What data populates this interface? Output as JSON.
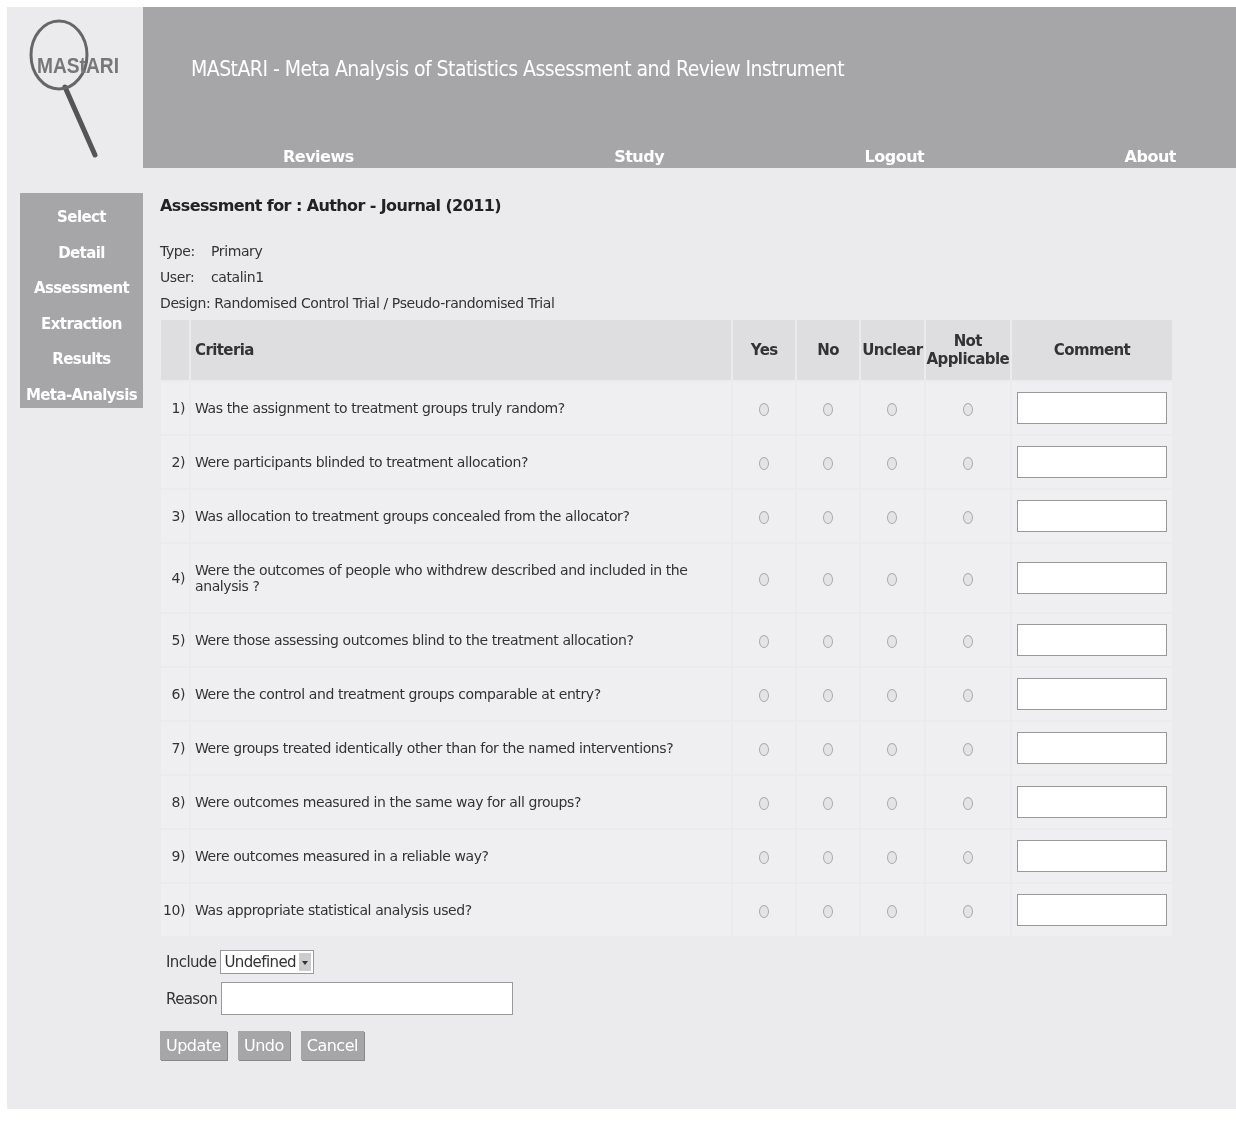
{
  "logo": {
    "text": "MAStARI"
  },
  "header": {
    "title": "MAStARI - Meta Analysis of Statistics Assessment and Review Instrument"
  },
  "nav": [
    {
      "label": "Reviews"
    },
    {
      "label": "Study"
    },
    {
      "label": "Logout"
    },
    {
      "label": "About"
    }
  ],
  "sidebar": {
    "items": [
      {
        "label": "Select"
      },
      {
        "label": "Detail"
      },
      {
        "label": "Assessment"
      },
      {
        "label": "Extraction"
      },
      {
        "label": "Results"
      },
      {
        "label": "Meta-Analysis"
      }
    ]
  },
  "heading": "Assessment for : Author - Journal (2011)",
  "details": [
    {
      "label": "Type:",
      "value": "Primary"
    },
    {
      "label": "User:",
      "value": "catalin1"
    },
    {
      "label": "Design:",
      "value": "Randomised Control Trial / Pseudo-randomised Trial"
    }
  ],
  "table": {
    "columns": [
      "Criteria",
      "Yes",
      "No",
      "Unclear",
      "Not Applicable",
      "Comment"
    ],
    "rows": [
      {
        "number": "1)",
        "criterion": "Was the assignment to treatment groups truly random?",
        "choices": [
          {
            "selected": false
          },
          {
            "selected": false
          },
          {
            "selected": false
          },
          {
            "selected": false
          }
        ]
      },
      {
        "number": "2)",
        "criterion": "Were participants blinded to treatment allocation?",
        "choices": [
          {
            "selected": false
          },
          {
            "selected": false
          },
          {
            "selected": false
          },
          {
            "selected": false
          }
        ]
      },
      {
        "number": "3)",
        "criterion": "Was allocation to treatment groups concealed from the allocator?",
        "choices": [
          {
            "selected": false
          },
          {
            "selected": false
          },
          {
            "selected": false
          },
          {
            "selected": false
          }
        ]
      },
      {
        "number": "4)",
        "criterion": "Were the outcomes of people who withdrew described and included in the analysis ?",
        "choices": [
          {
            "selected": false
          },
          {
            "selected": false
          },
          {
            "selected": false
          },
          {
            "selected": false
          }
        ]
      },
      {
        "number": "5)",
        "criterion": "Were those assessing outcomes blind to the treatment allocation?",
        "choices": [
          {
            "selected": false
          },
          {
            "selected": false
          },
          {
            "selected": false
          },
          {
            "selected": false
          }
        ]
      },
      {
        "number": "6)",
        "criterion": "Were the control and treatment groups comparable at entry?",
        "choices": [
          {
            "selected": false
          },
          {
            "selected": false
          },
          {
            "selected": false
          },
          {
            "selected": false
          }
        ]
      },
      {
        "number": "7)",
        "criterion": "Were groups treated identically other than for the named interventions?",
        "choices": [
          {
            "selected": false
          },
          {
            "selected": false
          },
          {
            "selected": false
          },
          {
            "selected": false
          }
        ]
      },
      {
        "number": "8)",
        "criterion": "Were outcomes measured in the same way for all groups?",
        "choices": [
          {
            "selected": false
          },
          {
            "selected": false
          },
          {
            "selected": false
          },
          {
            "selected": false
          }
        ]
      },
      {
        "number": "9)",
        "criterion": "Were outcomes measured in a reliable way?",
        "choices": [
          {
            "selected": false
          },
          {
            "selected": false
          },
          {
            "selected": false
          },
          {
            "selected": false
          }
        ]
      },
      {
        "number": "10)",
        "criterion": "Was appropriate statistical analysis used?",
        "choices": [
          {
            "selected": false
          },
          {
            "selected": false
          },
          {
            "selected": false
          },
          {
            "selected": false
          }
        ]
      }
    ]
  },
  "include": {
    "label": "Include",
    "value": "Undefined"
  },
  "reason": {
    "label": "Reason"
  },
  "buttons": [
    "Update",
    "Undo",
    "Cancel"
  ]
}
